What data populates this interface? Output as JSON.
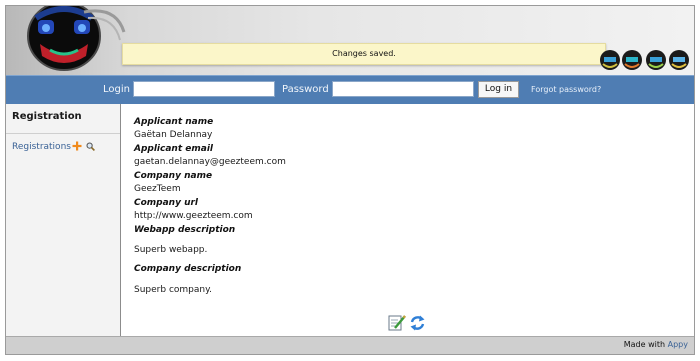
{
  "message": "Changes saved.",
  "login": {
    "login_label": "Login",
    "password_label": "Password",
    "login_value": "",
    "password_value": "",
    "button": "Log in",
    "forgot": "Forgot password?"
  },
  "sidebar": {
    "title": "Registration",
    "item": "Registrations",
    "icons": [
      "add-icon",
      "search-icon"
    ]
  },
  "fields": [
    {
      "label": "Applicant name",
      "value": "Gaëtan Delannay"
    },
    {
      "label": "Applicant email",
      "value": "gaetan.delannay@geezteem.com"
    },
    {
      "label": "Company name",
      "value": "GeezTeem"
    },
    {
      "label": "Company url",
      "value": "http://www.geezteem.com"
    },
    {
      "label": "Webapp description",
      "value": "Superb webapp."
    },
    {
      "label": "Company description",
      "value": "Superb company."
    }
  ],
  "actions": [
    "edit-icon",
    "refresh-icon"
  ],
  "footer": {
    "prefix": "Made with",
    "link": "Appy"
  },
  "colors": {
    "bar": "#4f7db3",
    "message_bg": "#fbf6c9",
    "link": "#3a6296"
  }
}
